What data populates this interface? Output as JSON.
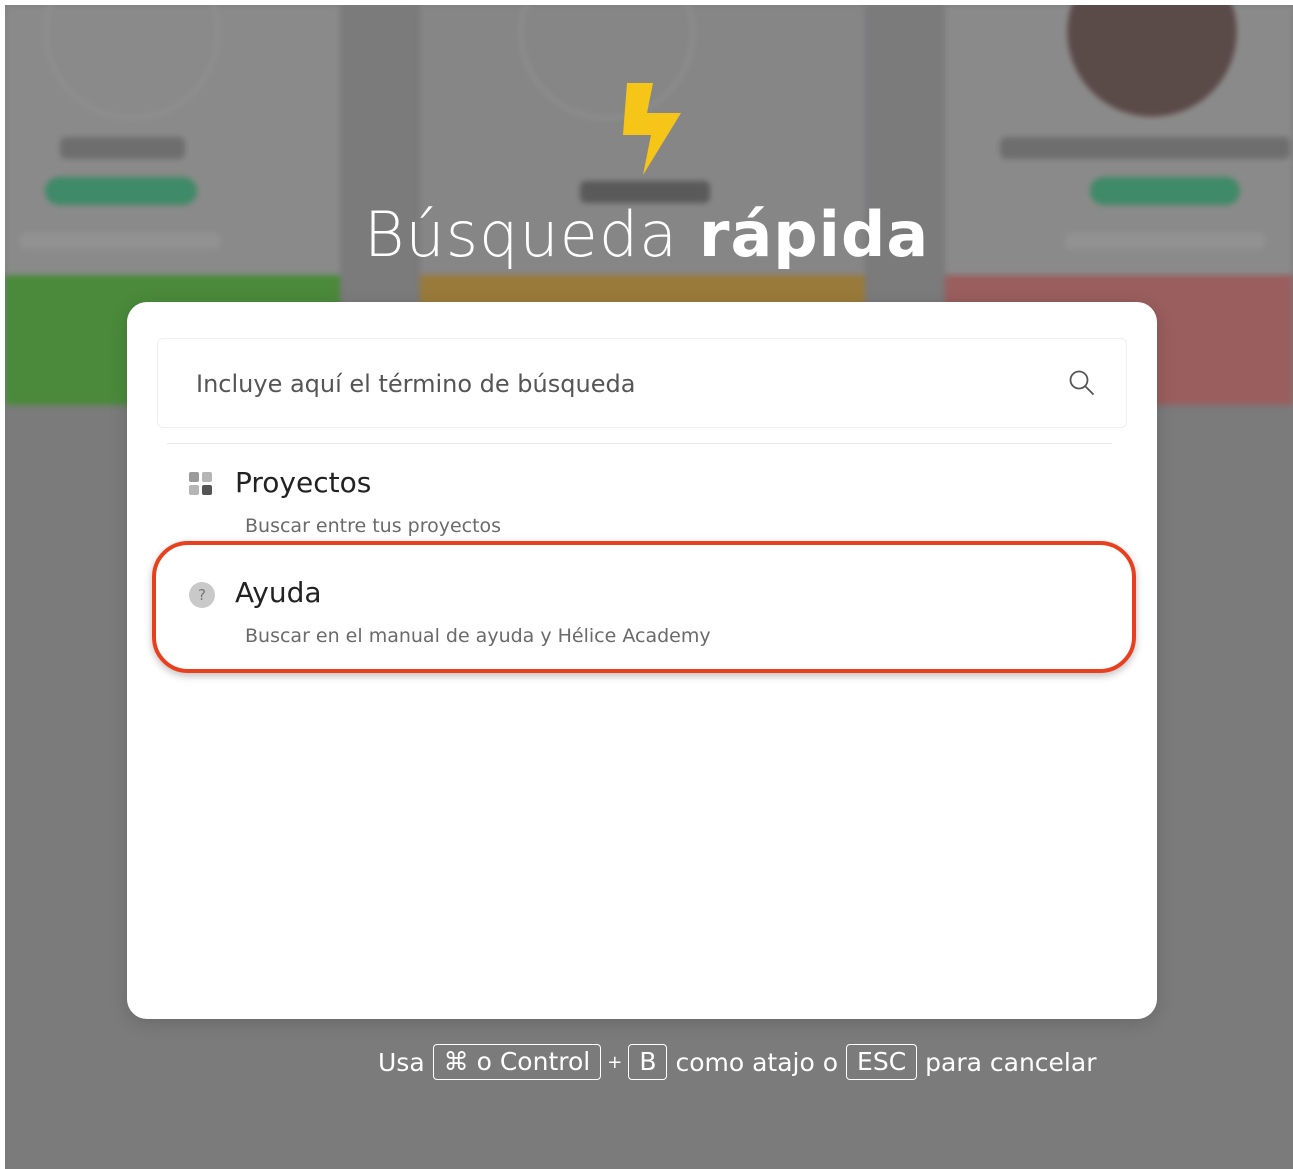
{
  "hero": {
    "icon": "lightning-bolt-icon",
    "title_regular": "Búsqueda",
    "title_bold": "rápida",
    "bolt_color": "#f5c518"
  },
  "search": {
    "placeholder": "Incluye aquí el término de búsqueda",
    "value": "",
    "icon": "search-icon"
  },
  "results": [
    {
      "icon": "grid-icon",
      "label": "Proyectos",
      "description": "Buscar entre tus proyectos"
    },
    {
      "icon": "help-icon",
      "label": "Ayuda",
      "description": "Buscar en el manual de ayuda y Hélice Academy",
      "highlighted": true
    }
  ],
  "hint": {
    "prefix": "Usa",
    "key_modifier": "⌘ o Control",
    "plus": "+",
    "key_letter": "B",
    "middle": "como atajo o",
    "key_escape": "ESC",
    "suffix": "para cancelar"
  },
  "colors": {
    "overlay": "#7b7b7c",
    "highlight": "#e8401f",
    "accent_green": "#3a9a52",
    "accent_orange": "#c8872a",
    "accent_red": "#b85a5a"
  }
}
